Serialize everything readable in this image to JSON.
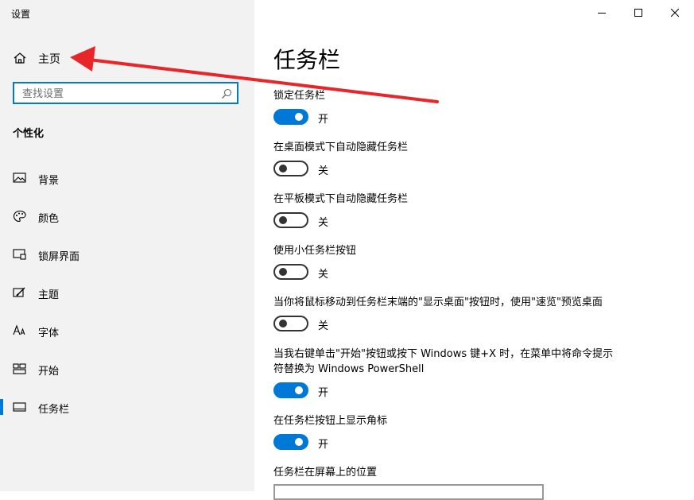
{
  "app": {
    "title": "设置"
  },
  "sidebar": {
    "home_label": "主页",
    "search_placeholder": "查找设置",
    "section_title": "个性化",
    "items": [
      {
        "label": "背景",
        "icon": "image-icon"
      },
      {
        "label": "颜色",
        "icon": "palette-icon"
      },
      {
        "label": "锁屏界面",
        "icon": "lock-screen-icon"
      },
      {
        "label": "主题",
        "icon": "theme-icon"
      },
      {
        "label": "字体",
        "icon": "font-icon"
      },
      {
        "label": "开始",
        "icon": "start-icon"
      },
      {
        "label": "任务栏",
        "icon": "taskbar-icon",
        "active": true
      }
    ]
  },
  "main": {
    "title": "任务栏",
    "settings": [
      {
        "label": "锁定任务栏",
        "state": "开",
        "on": true
      },
      {
        "label": "在桌面模式下自动隐藏任务栏",
        "state": "关",
        "on": false
      },
      {
        "label": "在平板模式下自动隐藏任务栏",
        "state": "关",
        "on": false
      },
      {
        "label": "使用小任务栏按钮",
        "state": "关",
        "on": false
      },
      {
        "label": "当你将鼠标移动到任务栏末端的\"显示桌面\"按钮时，使用\"速览\"预览桌面",
        "state": "关",
        "on": false
      },
      {
        "label": "当我右键单击\"开始\"按钮或按下 Windows 键+X 时，在菜单中将命令提示符替换为 Windows PowerShell",
        "state": "开",
        "on": true
      },
      {
        "label": "在任务栏按钮上显示角标",
        "state": "开",
        "on": true
      }
    ],
    "position_label": "任务栏在屏幕上的位置"
  },
  "colors": {
    "accent": "#0078d7",
    "annotation_arrow": "#e8262a",
    "sidebar_bg": "#f2f2f2"
  }
}
